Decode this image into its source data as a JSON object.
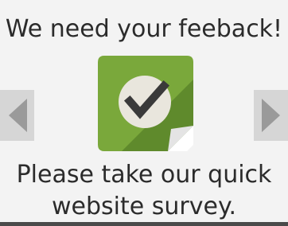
{
  "survey_prompt": {
    "headline": "We need your feeback!",
    "line1": "Please take our quick",
    "line2": "website survey."
  },
  "icons": {
    "logo": "survey-checkmark-icon",
    "previous": "left-arrow-icon",
    "next": "right-arrow-icon"
  },
  "colors": {
    "background": "#f3f3f3",
    "text": "#2b2b2b",
    "logo_green": "#7aa83b",
    "logo_green_dark": "#5f8a2c",
    "arrow_bg": "#d6d6d6",
    "arrow_fill": "#9a9a9a"
  }
}
